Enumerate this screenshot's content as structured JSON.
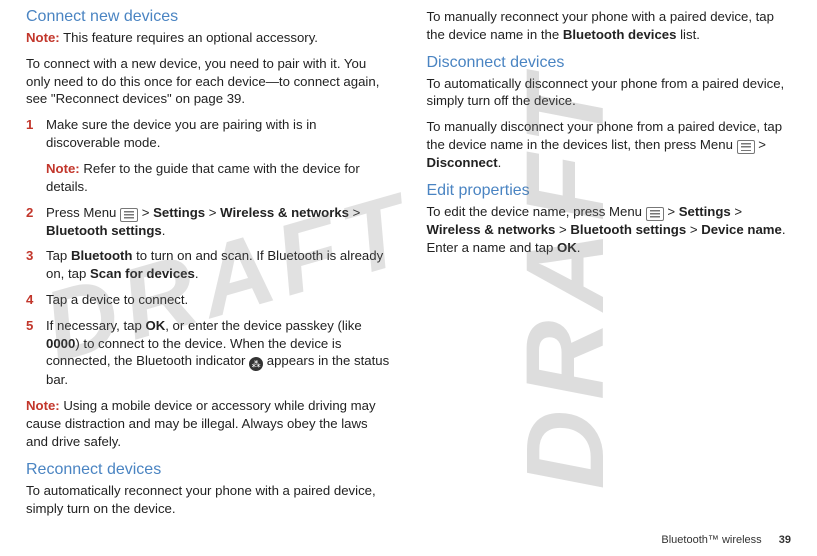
{
  "watermark": "DRAFT",
  "left": {
    "h1": "Connect new devices",
    "note1_label": "Note:",
    "note1_text": " This feature requires an optional accessory.",
    "p1": "To connect with a new device, you need to pair with it. You only need to do this once for each device—to connect again, see \"Reconnect devices\" on page 39.",
    "steps": [
      {
        "n": "1",
        "text": "Make sure the device you are pairing with is in discoverable mode.",
        "subnote_label": "Note:",
        "subnote_text": " Refer to the guide that came with the device for details."
      },
      {
        "n": "2",
        "pre": "Press Menu ",
        "mid1": " > ",
        "b1": "Settings",
        "mid2": " > ",
        "b2": "Wireless & networks",
        "mid3": " > ",
        "b3": "Bluetooth settings",
        "post": "."
      },
      {
        "n": "3",
        "pre": "Tap ",
        "b1": "Bluetooth",
        "mid1": " to turn on and scan. If Bluetooth is already on, tap ",
        "b2": "Scan for devices",
        "post": "."
      },
      {
        "n": "4",
        "text": "Tap a device to connect."
      },
      {
        "n": "5",
        "pre": "If necessary, tap ",
        "b1": "OK",
        "mid1": ", or enter the device passkey (like ",
        "b2": "0000",
        "mid2": ") to connect to the device. When the device is connected, the Bluetooth indicator ",
        "post": " appears in the status bar."
      }
    ],
    "note2_label": "Note:",
    "note2_text": " Using a mobile device or accessory while driving may cause distraction and may be illegal. Always obey the laws and drive safely.",
    "h2": "Reconnect devices",
    "p2": "To automatically reconnect your phone with a paired device, simply turn on the device."
  },
  "right": {
    "p1_a": "To manually reconnect your phone with a paired device, tap the device name in the ",
    "p1_b": "Bluetooth devices",
    "p1_c": " list.",
    "h1": "Disconnect devices",
    "p2": "To automatically disconnect your phone from a paired device, simply turn off the device.",
    "p3_a": "To manually disconnect your phone from a paired device, tap the device name in the devices list, then press Menu ",
    "p3_b": " > ",
    "p3_c": "Disconnect",
    "p3_d": ".",
    "h2": "Edit properties",
    "p4_a": "To edit the device name, press Menu ",
    "p4_b": " > ",
    "p4_c": "Settings",
    "p4_d": " > ",
    "p4_e": "Wireless & networks",
    "p4_f": " > ",
    "p4_g": "Bluetooth settings",
    "p4_h": " > ",
    "p4_i": "Device name",
    "p4_j": ". Enter a name and tap ",
    "p4_k": "OK",
    "p4_l": "."
  },
  "footer": {
    "section": "Bluetooth™ wireless",
    "page": "39"
  }
}
